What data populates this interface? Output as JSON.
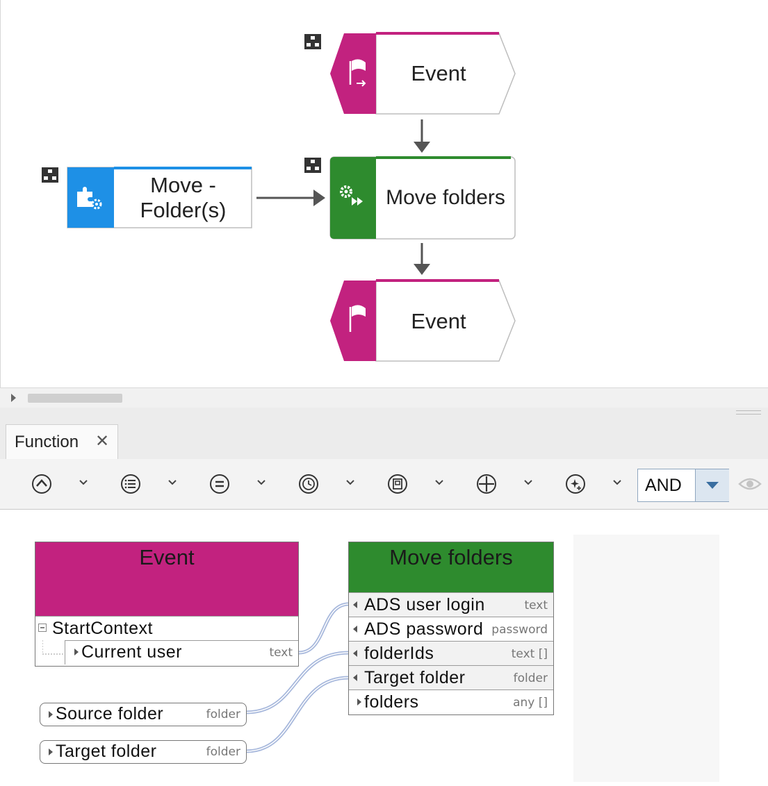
{
  "diagram": {
    "top_event_label": "Event",
    "bottom_event_label": "Event",
    "function_label": "Move folders",
    "service_label_line1": "Move -",
    "service_label_line2": "Folder(s)"
  },
  "panel": {
    "tab_label": "Function",
    "tab_close": "✕",
    "operator_label": "AND"
  },
  "colors": {
    "event": "#c2227f",
    "function": "#2e8b2e",
    "service": "#1e90e6"
  },
  "mapping": {
    "event_box": {
      "title": "Event",
      "group": "StartContext",
      "rows": [
        {
          "label": "Current user",
          "type": "text"
        }
      ]
    },
    "function_box": {
      "title": "Move folders",
      "rows": [
        {
          "label": "ADS user login",
          "type": "text"
        },
        {
          "label": "ADS password",
          "type": "password"
        },
        {
          "label": "folderIds",
          "type": "text []"
        },
        {
          "label": "Target folder",
          "type": "folder"
        },
        {
          "label": "folders",
          "type": "any []"
        }
      ]
    },
    "constants": [
      {
        "label": "Source folder",
        "type": "folder"
      },
      {
        "label": "Target folder",
        "type": "folder"
      }
    ]
  }
}
